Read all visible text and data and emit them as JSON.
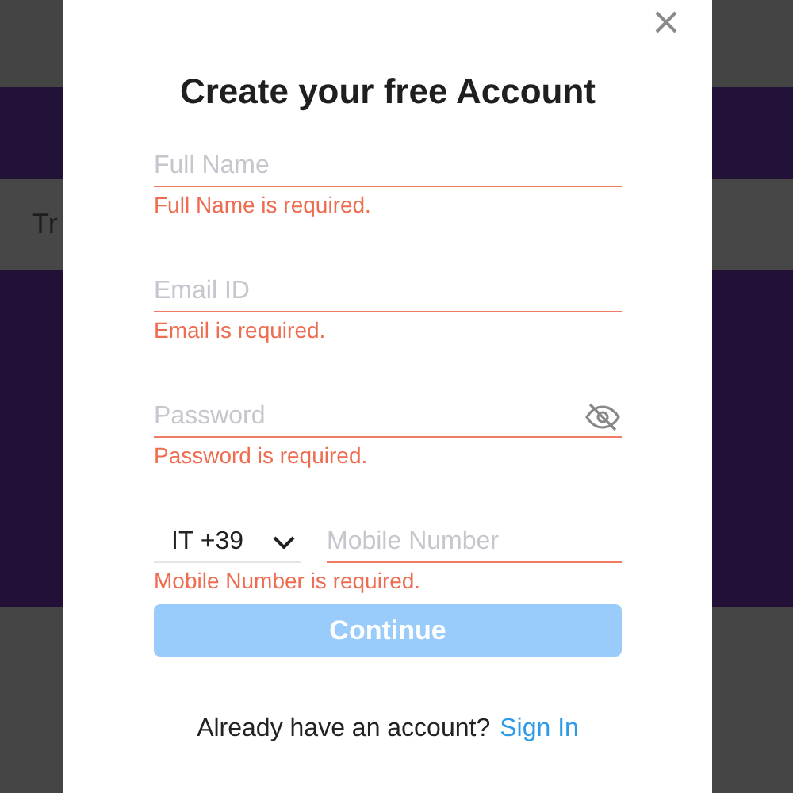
{
  "background": {
    "partial_text": "Tr"
  },
  "dialog": {
    "title": "Create your free Account",
    "fields": [
      {
        "kind": "text",
        "placeholder": "Full Name",
        "error": "Full Name is required."
      },
      {
        "kind": "text",
        "placeholder": "Email ID",
        "error": "Email is required."
      },
      {
        "kind": "password",
        "placeholder": "Password",
        "error": "Password is required."
      },
      {
        "kind": "phone",
        "country_code": "IT +39",
        "placeholder": "Mobile Number",
        "error": "Mobile Number is required."
      }
    ],
    "submit": {
      "label": "Continue",
      "disabled": true
    },
    "footer": {
      "text": "Already have an account?",
      "link": "Sign In"
    }
  }
}
